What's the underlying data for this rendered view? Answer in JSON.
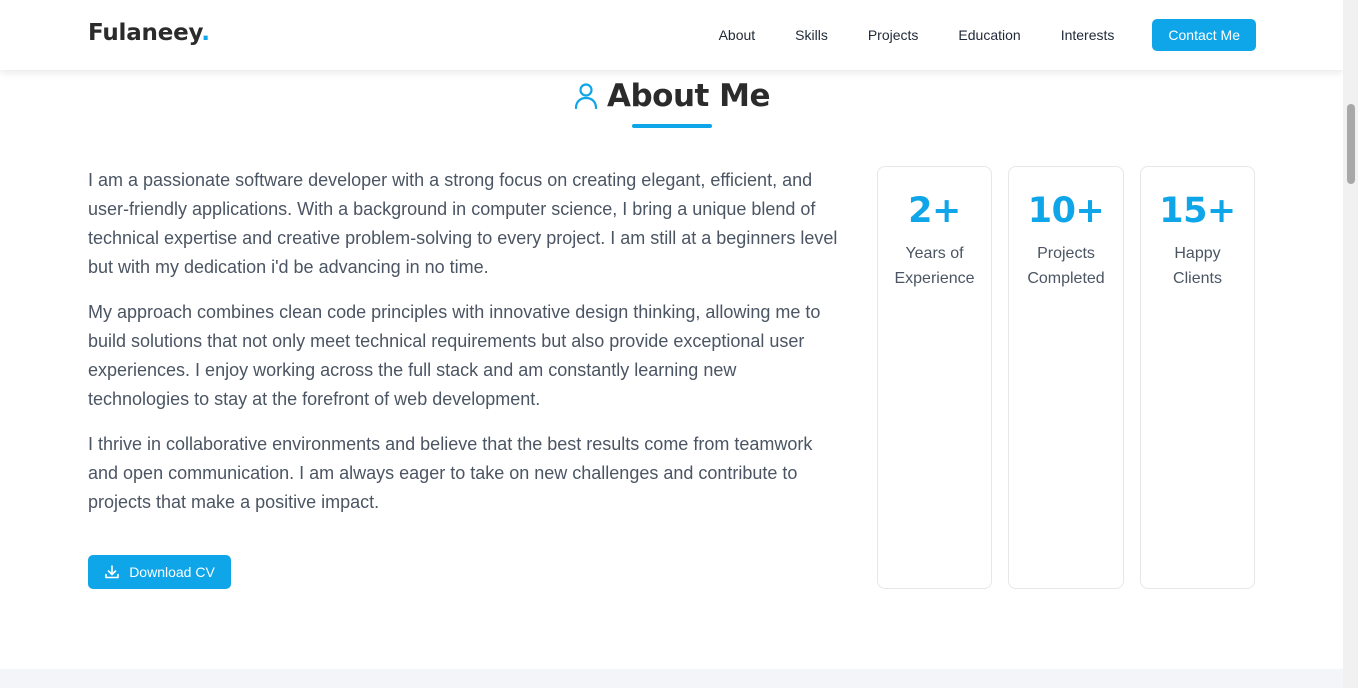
{
  "brand": {
    "name": "Fulaneey",
    "dot": "."
  },
  "nav": {
    "links": [
      "About",
      "Skills",
      "Projects",
      "Education",
      "Interests"
    ],
    "cta": "Contact Me"
  },
  "about": {
    "icon": "user-icon",
    "title": "About Me",
    "paragraphs": [
      "I am a passionate software developer with a strong focus on creating elegant, efficient, and user-friendly applications. With a background in computer science, I bring a unique blend of technical expertise and creative problem-solving to every project. I am still at a beginners level but with my dedication i'd be advancing in no time.",
      "My approach combines clean code principles with innovative design thinking, allowing me to build solutions that not only meet technical requirements but also provide exceptional user experiences. I enjoy working across the full stack and am constantly learning new technologies to stay at the forefront of web development.",
      "I thrive in collaborative environments and believe that the best results come from teamwork and open communication. I am always eager to take on new challenges and contribute to projects that make a positive impact."
    ],
    "download_label": "Download CV",
    "download_icon": "download-icon"
  },
  "stats": [
    {
      "number": "2+",
      "label_line1": "Years of",
      "label_line2": "Experience"
    },
    {
      "number": "10+",
      "label_line1": "Projects",
      "label_line2": "Completed"
    },
    {
      "number": "15+",
      "label_line1": "Happy",
      "label_line2": "Clients"
    }
  ],
  "colors": {
    "accent": "#0ea5e9",
    "heading": "#2b2b2b",
    "body_text": "#4b5563",
    "card_border": "#e5e7eb"
  }
}
